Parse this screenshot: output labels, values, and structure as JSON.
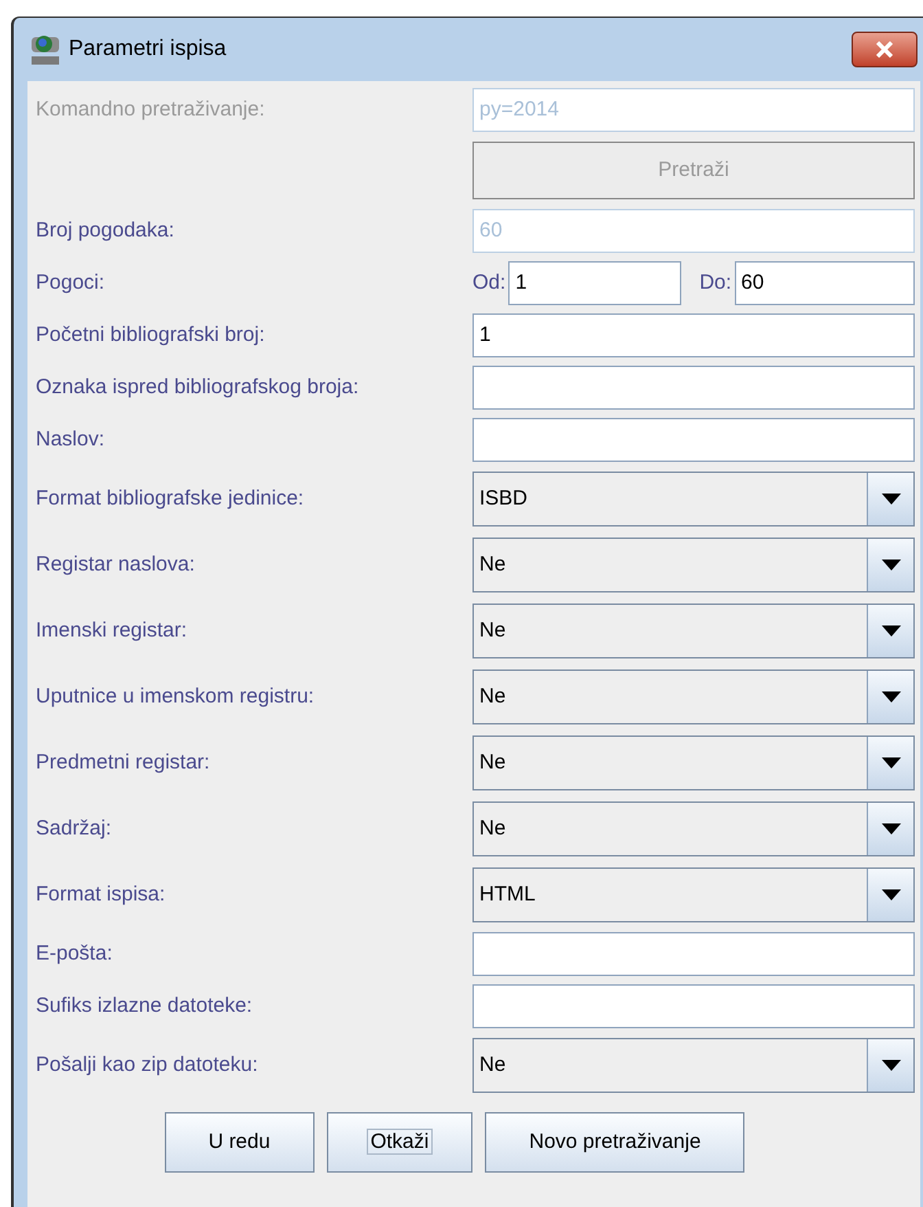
{
  "window": {
    "title": "Parametri ispisa"
  },
  "rows": [
    {
      "kind": "text",
      "label": "Komandno pretraživanje:",
      "label_disabled": true,
      "value": "py=2014",
      "disabled": true
    },
    {
      "kind": "button",
      "label_text": "Pretraži",
      "disabled": true
    },
    {
      "kind": "text",
      "label": "Broj pogodaka:",
      "label_disabled": false,
      "value": "60",
      "disabled": true
    },
    {
      "kind": "range",
      "label": "Pogoci:",
      "from_label": "Od:",
      "from_value": "1",
      "to_label": "Do:",
      "to_value": "60"
    },
    {
      "kind": "text",
      "label": "Početni bibliografski broj:",
      "label_disabled": false,
      "value": "1",
      "disabled": false
    },
    {
      "kind": "text",
      "label": "Oznaka ispred bibliografskog broja:",
      "label_disabled": false,
      "disabled": false
    },
    {
      "kind": "text",
      "label": "Naslov:",
      "label_disabled": false,
      "disabled": false
    },
    {
      "kind": "combo",
      "label": "Format bibliografske jedinice:",
      "value": "ISBD"
    },
    {
      "kind": "combo",
      "label": "Registar naslova:",
      "value": "Ne"
    },
    {
      "kind": "combo",
      "label": "Imenski registar:",
      "value": "Ne"
    },
    {
      "kind": "combo",
      "label": "Uputnice u imenskom registru:",
      "value": "Ne"
    },
    {
      "kind": "combo",
      "label": "Predmetni registar:",
      "value": "Ne"
    },
    {
      "kind": "combo",
      "label": "Sadržaj:",
      "value": "Ne"
    },
    {
      "kind": "combo",
      "label": "Format ispisa:",
      "value": "HTML"
    },
    {
      "kind": "text",
      "label": "E-pošta:",
      "label_disabled": false,
      "disabled": false
    },
    {
      "kind": "text",
      "label": "Sufiks izlazne datoteke:",
      "label_disabled": false,
      "disabled": false
    },
    {
      "kind": "combo",
      "label": "Pošalji kao zip datoteku:",
      "value": "Ne"
    }
  ],
  "buttons": [
    {
      "label": "U redu",
      "focused": false
    },
    {
      "label": "Otkaži",
      "focused": true
    },
    {
      "label": "Novo pretraživanje",
      "focused": false
    }
  ]
}
